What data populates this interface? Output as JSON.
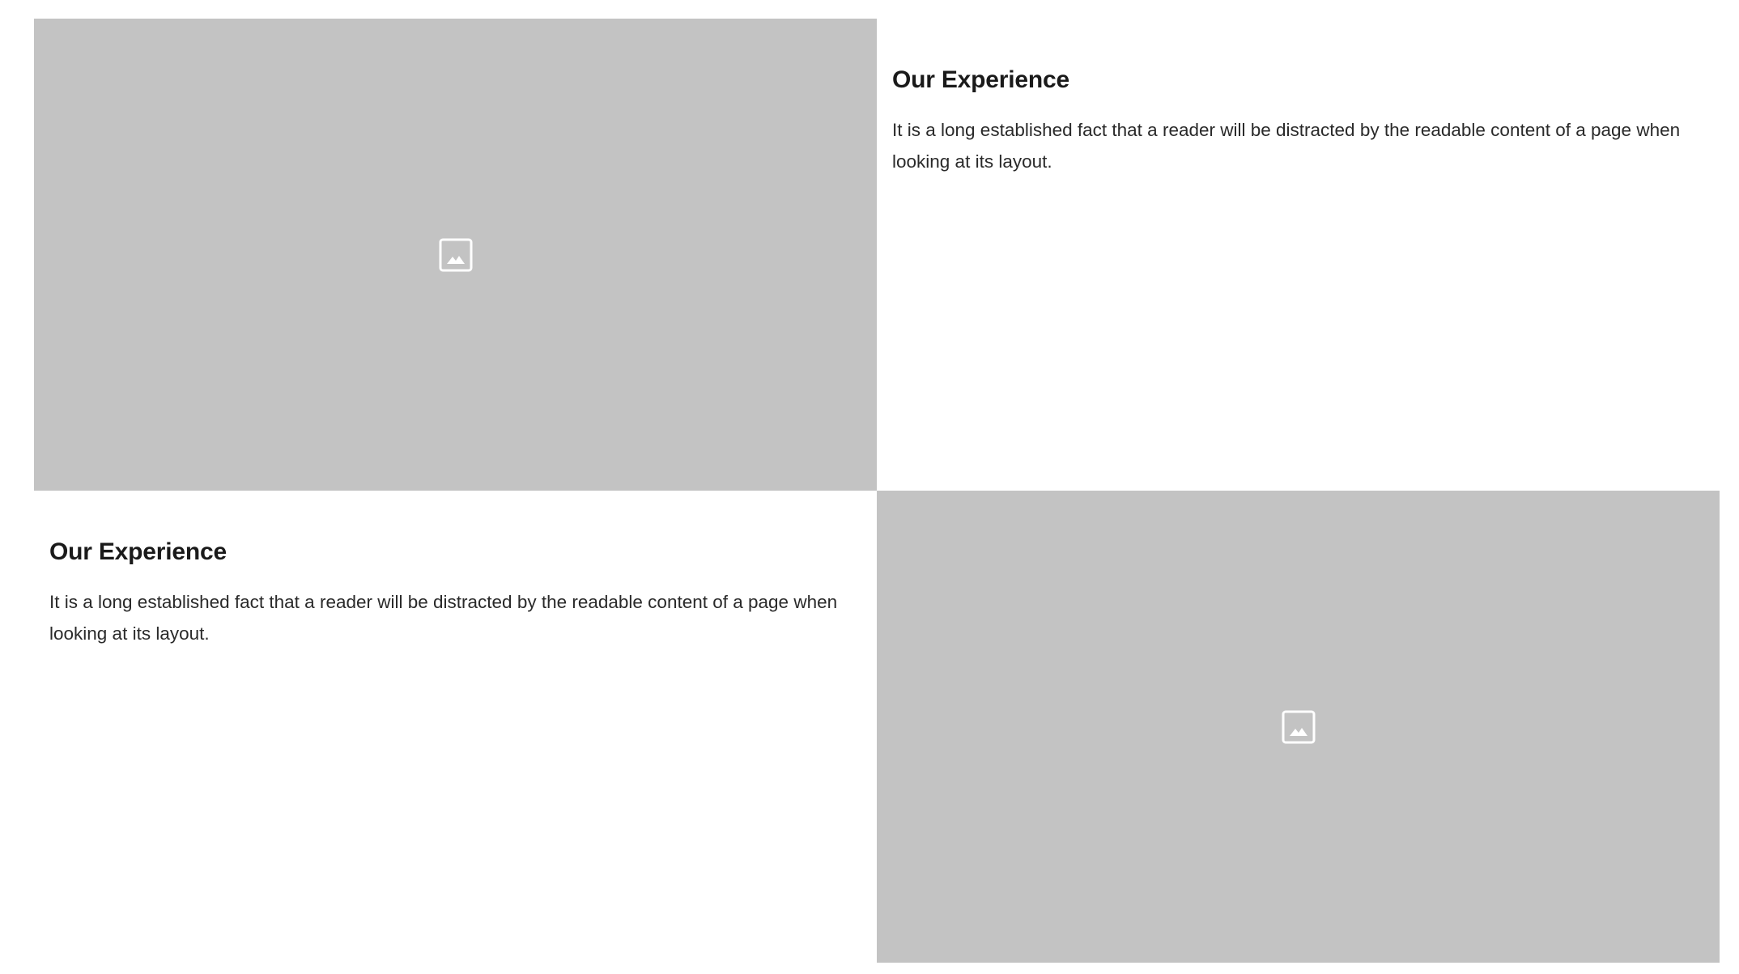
{
  "rows": [
    {
      "image": {
        "icon": "image-placeholder-icon",
        "background": "#c3c3c3"
      },
      "heading": "Our Experience",
      "body": "It is a long established fact that a reader will be distracted by the readable content of a page when looking at its layout."
    },
    {
      "image": {
        "icon": "image-placeholder-icon",
        "background": "#c3c3c3"
      },
      "heading": "Our Experience",
      "body": "It is a long established fact that a reader will be distracted by the readable content of a page when looking at its layout."
    }
  ]
}
